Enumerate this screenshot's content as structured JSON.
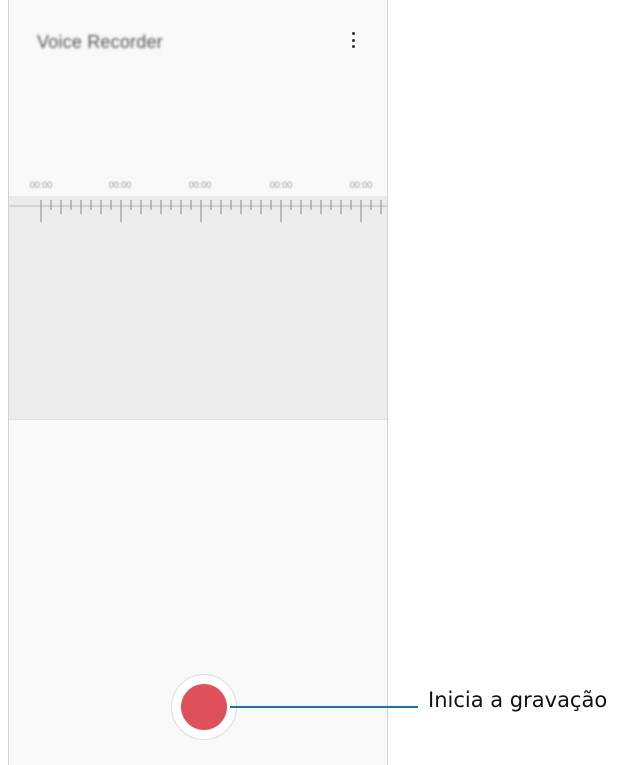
{
  "app": {
    "title": "Voice Recorder",
    "more_icon": "more-vert-icon"
  },
  "timeline": {
    "labels": [
      "00:00",
      "00:00",
      "00:00",
      "00:00",
      "00:00"
    ]
  },
  "record": {
    "icon": "record-icon",
    "color": "#e0505a"
  },
  "callout": {
    "text": "Inicia a gravação",
    "line_color": "#1e6fb0"
  }
}
